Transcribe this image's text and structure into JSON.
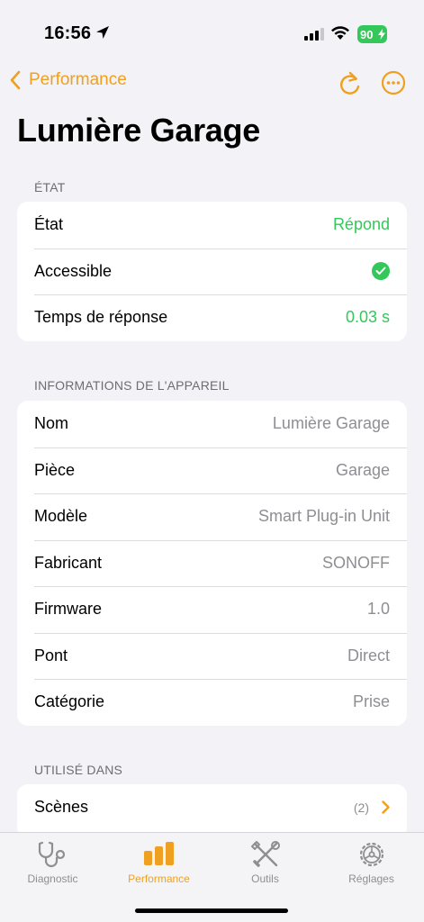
{
  "status": {
    "time": "16:56",
    "battery": "90"
  },
  "nav": {
    "back_label": "Performance"
  },
  "title": "Lumière Garage",
  "sections": {
    "etat": {
      "header": "ÉTAT",
      "rows": [
        {
          "label": "État",
          "value": "Répond"
        },
        {
          "label": "Accessible"
        },
        {
          "label": "Temps de réponse",
          "value": "0.03 s"
        }
      ]
    },
    "info": {
      "header": "INFORMATIONS DE L'APPAREIL",
      "rows": [
        {
          "label": "Nom",
          "value": "Lumière Garage"
        },
        {
          "label": "Pièce",
          "value": "Garage"
        },
        {
          "label": "Modèle",
          "value": "Smart Plug-in Unit"
        },
        {
          "label": "Fabricant",
          "value": "SONOFF"
        },
        {
          "label": "Firmware",
          "value": "1.0"
        },
        {
          "label": "Pont",
          "value": "Direct"
        },
        {
          "label": "Catégorie",
          "value": "Prise"
        }
      ]
    },
    "used": {
      "header": "UTILISÉ DANS",
      "rows": [
        {
          "label": "Scènes",
          "count": "(2)"
        }
      ]
    }
  },
  "tabs": [
    {
      "label": "Diagnostic",
      "icon": "stethoscope-icon"
    },
    {
      "label": "Performance",
      "icon": "bar-chart-icon",
      "active": true
    },
    {
      "label": "Outils",
      "icon": "tools-icon"
    },
    {
      "label": "Réglages",
      "icon": "gear-icon"
    }
  ],
  "colors": {
    "accent": "#f0a020",
    "green": "#34c759",
    "background": "#f2f2f7"
  }
}
